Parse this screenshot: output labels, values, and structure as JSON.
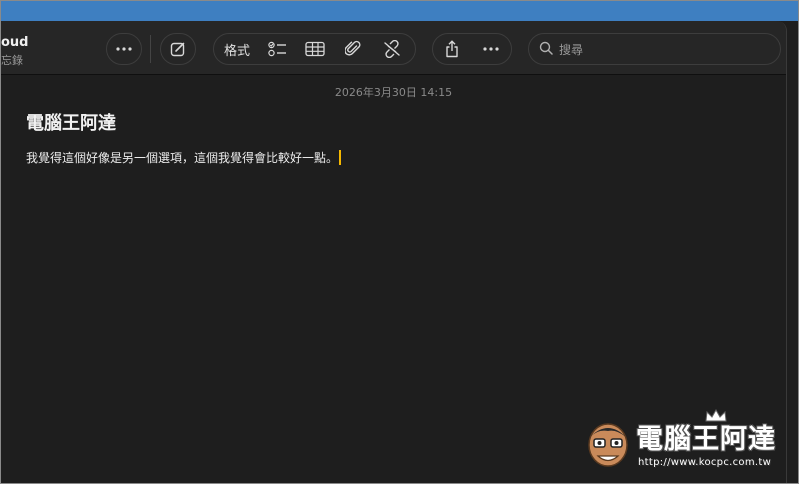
{
  "sidebar": {
    "folder_title": "oud",
    "folder_subtitle": "忘錄"
  },
  "toolbar": {
    "more_icon": "ellipsis-icon",
    "compose_icon": "compose-icon",
    "format_label": "格式",
    "checklist_icon": "checklist-icon",
    "table_icon": "table-icon",
    "attachment_icon": "paperclip-icon",
    "collaborate_icon": "link-off-icon",
    "share_icon": "share-icon",
    "more2_icon": "ellipsis-icon",
    "search_placeholder": "搜尋"
  },
  "note": {
    "timestamp": "2026年3月30日 14:15",
    "title": "電腦王阿達",
    "body": "我覺得這個好像是另一個選項，這個我覺得會比較好一點。"
  },
  "watermark": {
    "text": "電腦王阿達",
    "url": "http://www.kocpc.com.tw"
  },
  "colors": {
    "background": "#1e1e1e",
    "toolbar": "#262626",
    "caret": "#f5b800",
    "desktop": "#3e7fc1"
  }
}
